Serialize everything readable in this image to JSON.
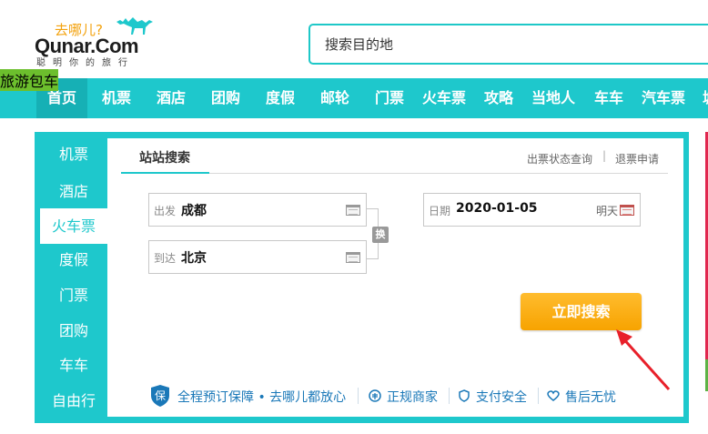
{
  "header": {
    "slogan_top": "去哪儿?",
    "brand": "Qunar.Com",
    "slogan_bottom": "聪明你的旅行",
    "search_placeholder": "搜索目的地"
  },
  "nav": {
    "items": [
      "首页",
      "机票",
      "酒店",
      "团购",
      "度假",
      "邮轮",
      "门票",
      "火车票",
      "攻略",
      "当地人",
      "车车",
      "汽车票",
      "城"
    ],
    "badge": "旅游包车"
  },
  "sidebar": {
    "items": [
      "机票",
      "酒店",
      "火车票",
      "度假",
      "门票",
      "团购",
      "车车",
      "自由行"
    ],
    "active_index": 2
  },
  "panel": {
    "tab_title": "站站搜索",
    "link_status": "出票状态查询",
    "link_separator": "|",
    "link_refund": "退票申请",
    "from": {
      "label": "出发",
      "value": "成都"
    },
    "to": {
      "label": "到达",
      "value": "北京"
    },
    "swap_label": "换",
    "date": {
      "label": "日期",
      "value": "2020-01-05",
      "hint": "明天"
    },
    "search_button": "立即搜索"
  },
  "guarantees": {
    "main": "全程预订保障 • 去哪儿都放心",
    "items": [
      "正规商家",
      "支付安全",
      "售后无忧"
    ]
  },
  "colors": {
    "brand_teal": "#1ec8cc",
    "button_orange": "#f7a300",
    "annotation_red": "#e8202a"
  }
}
